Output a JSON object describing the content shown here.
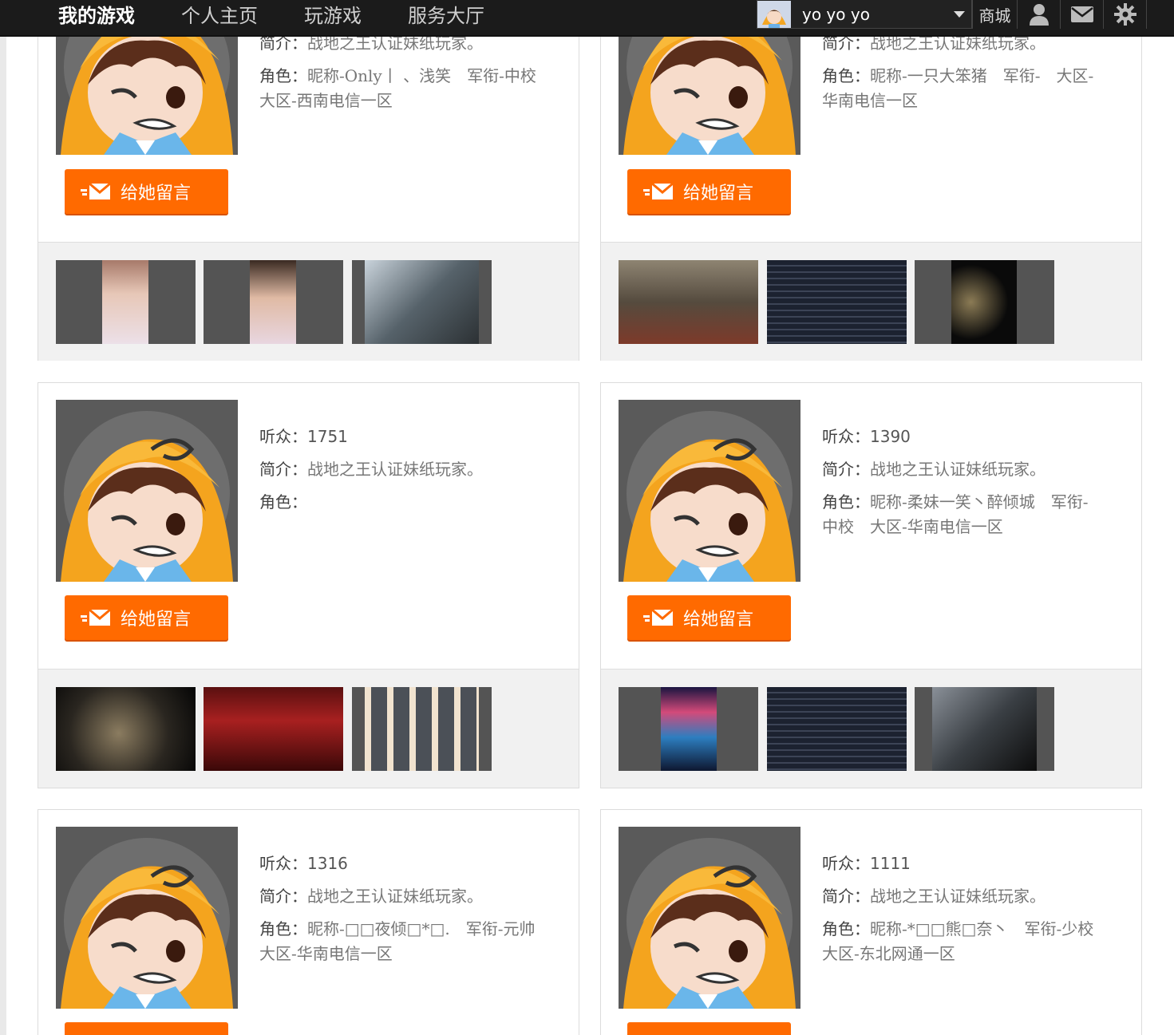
{
  "nav": {
    "my_games": "我的游戏",
    "home": "个人主页",
    "play": "玩游戏",
    "service": "服务大厅"
  },
  "user": {
    "name": "yo yo yo",
    "icon": "avatar"
  },
  "toolbar": {
    "shop": "商城",
    "icons": [
      "user-icon",
      "mail-icon",
      "settings-icon"
    ]
  },
  "labels": {
    "listeners": "听众：",
    "intro": "简介：",
    "role": "角色："
  },
  "message_button": "给她留言",
  "cards": [
    {
      "intro": "战地之王认证妹纸玩家。",
      "role_line1": "昵称-Only丨 、浅笑　军衔-中校",
      "role_line2": "大区-西南电信一区"
    },
    {
      "intro": "战地之王认证妹纸玩家。",
      "role_line1": "昵称-一只大笨猪　军衔-　大区-",
      "role_line2": "华南电信一区"
    },
    {
      "listeners": "1751",
      "intro": "战地之王认证妹纸玩家。",
      "role_line1": "",
      "role_line2": ""
    },
    {
      "listeners": "1390",
      "intro": "战地之王认证妹纸玩家。",
      "role_line1": "昵称-柔妹一笑丶醉倾城　军衔-",
      "role_line2": "中校　大区-华南电信一区"
    },
    {
      "listeners": "1316",
      "intro": "战地之王认证妹纸玩家。",
      "role_line1": "昵称-□□夜倾□*□.　军衔-元帅",
      "role_line2": "大区-华南电信一区"
    },
    {
      "listeners": "1111",
      "intro": "战地之王认证妹纸玩家。",
      "role_line1": "昵称-*□□熊□奈丶　军衔-少校",
      "role_line2": "大区-东北网通一区"
    }
  ],
  "colors": {
    "accent": "#ff6a00",
    "topbar": "#1b1b1b",
    "gallery_bg": "#f1f1f1"
  }
}
